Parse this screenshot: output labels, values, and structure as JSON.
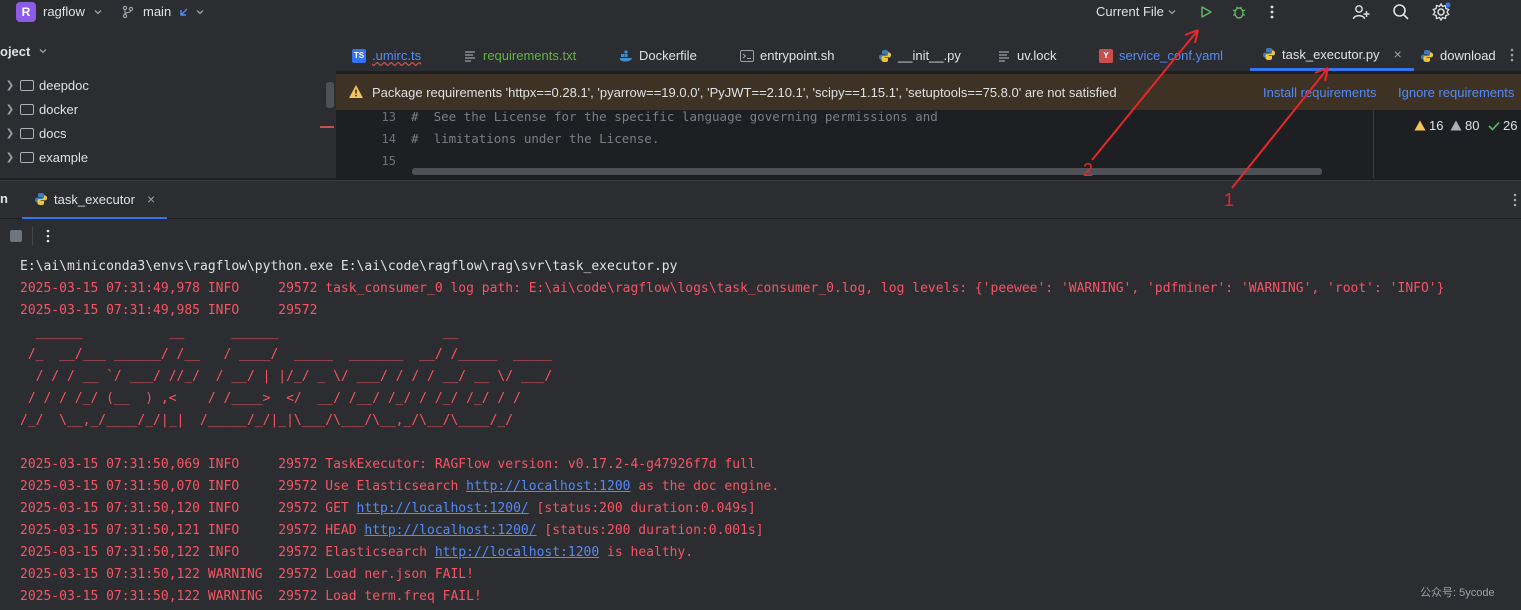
{
  "titlebar": {
    "project_badge": "R",
    "project_name": "ragflow",
    "branch": "main",
    "run_config": "Current File"
  },
  "project_panel": {
    "header": "oject",
    "items": [
      {
        "label": "deepdoc"
      },
      {
        "label": "docker"
      },
      {
        "label": "docs"
      },
      {
        "label": "example"
      }
    ]
  },
  "tabs": [
    {
      "label": ".umirc.ts",
      "icon": "typescript-icon",
      "color": "#548af7"
    },
    {
      "label": "requirements.txt",
      "icon": "text-file-icon",
      "color": "#62b543"
    },
    {
      "label": "Dockerfile",
      "icon": "docker-icon",
      "color": "#dfe1e5"
    },
    {
      "label": "entrypoint.sh",
      "icon": "shell-icon",
      "color": "#dfe1e5"
    },
    {
      "label": "__init__.py",
      "icon": "python-icon",
      "color": "#dfe1e5"
    },
    {
      "label": "uv.lock",
      "icon": "text-file-icon",
      "color": "#dfe1e5"
    },
    {
      "label": "service_conf.yaml",
      "icon": "yaml-icon",
      "color": "#548af7"
    },
    {
      "label": "task_executor.py",
      "icon": "python-icon",
      "color": "#dfe1e5"
    },
    {
      "label": "download",
      "icon": "python-icon",
      "color": "#dfe1e5"
    }
  ],
  "warning": {
    "text": "Package requirements 'httpx==0.28.1', 'pyarrow==19.0.0', 'PyJWT==2.10.1', 'scipy==1.15.1', 'setuptools==75.8.0' are not satisfied",
    "install_link": "Install requirements",
    "ignore_link": "Ignore requirements"
  },
  "editor": {
    "lines": [
      {
        "num": "13",
        "text": "#  See the License for the specific language governing permissions and"
      },
      {
        "num": "14",
        "text": "#  limitations under the License."
      },
      {
        "num": "15",
        "text": ""
      }
    ]
  },
  "inspections": {
    "warnings": "16",
    "weak_warnings": "80",
    "ok": "26"
  },
  "annotations": {
    "label_1": "1",
    "label_2": "2"
  },
  "run": {
    "tab_label": "task_executor",
    "console": [
      {
        "text": "E:\\ai\\miniconda3\\envs\\ragflow\\python.exe E:\\ai\\code\\ragflow\\rag\\svr\\task_executor.py",
        "color": "#dfe1e5"
      },
      {
        "text": "2025-03-15 07:31:49,978 INFO     29572 task_consumer_0 log path: E:\\ai\\code\\ragflow\\logs\\task_consumer_0.log, log levels: {'peewee': 'WARNING', 'pdfminer': 'WARNING', 'root': 'INFO'}",
        "color": "#f75464"
      },
      {
        "text": "2025-03-15 07:31:49,985 INFO     29572",
        "color": "#f75464"
      },
      {
        "text": "  ______           __      ______                     __",
        "color": "#f75464"
      },
      {
        "text": " /_  __/___ ______/ /__   / ____/  _____  _______  __/ /_____  _____",
        "color": "#f75464"
      },
      {
        "text": "  / / / __ `/ ___/ //_/  / __/ | |/_/ _ \\/ ___/ / / / __/ __ \\/ ___/",
        "color": "#f75464"
      },
      {
        "text": " / / / /_/ (__  ) ,<    / /____>  </  __/ /__/ /_/ / /_/ /_/ / /",
        "color": "#f75464"
      },
      {
        "text": "/_/  \\__,_/____/_/|_|  /_____/_/|_|\\___/\\___/\\__,_/\\__/\\____/_/",
        "color": "#f75464"
      },
      {
        "text": "",
        "color": "#f75464"
      },
      {
        "text": "2025-03-15 07:31:50,069 INFO     29572 TaskExecutor: RAGFlow version: v0.17.2-4-g47926f7d full",
        "color": "#f75464"
      },
      {
        "pre": "2025-03-15 07:31:50,070 INFO     29572 Use Elasticsearch ",
        "link": "http://localhost:1200",
        "post": " as the doc engine.",
        "color": "#f75464"
      },
      {
        "pre": "2025-03-15 07:31:50,120 INFO     29572 GET ",
        "link": "http://localhost:1200/",
        "post": " [status:200 duration:0.049s]",
        "color": "#f75464"
      },
      {
        "pre": "2025-03-15 07:31:50,121 INFO     29572 HEAD ",
        "link": "http://localhost:1200/",
        "post": " [status:200 duration:0.001s]",
        "color": "#f75464"
      },
      {
        "pre": "2025-03-15 07:31:50,122 INFO     29572 Elasticsearch ",
        "link": "http://localhost:1200",
        "post": " is healthy.",
        "color": "#f75464"
      },
      {
        "text": "2025-03-15 07:31:50,122 WARNING  29572 Load ner.json FAIL!",
        "color": "#f75464"
      },
      {
        "text": "2025-03-15 07:31:50,122 WARNING  29572 Load term.freq FAIL!",
        "color": "#f75464"
      }
    ]
  },
  "watermark": "公众号: 5ycode"
}
